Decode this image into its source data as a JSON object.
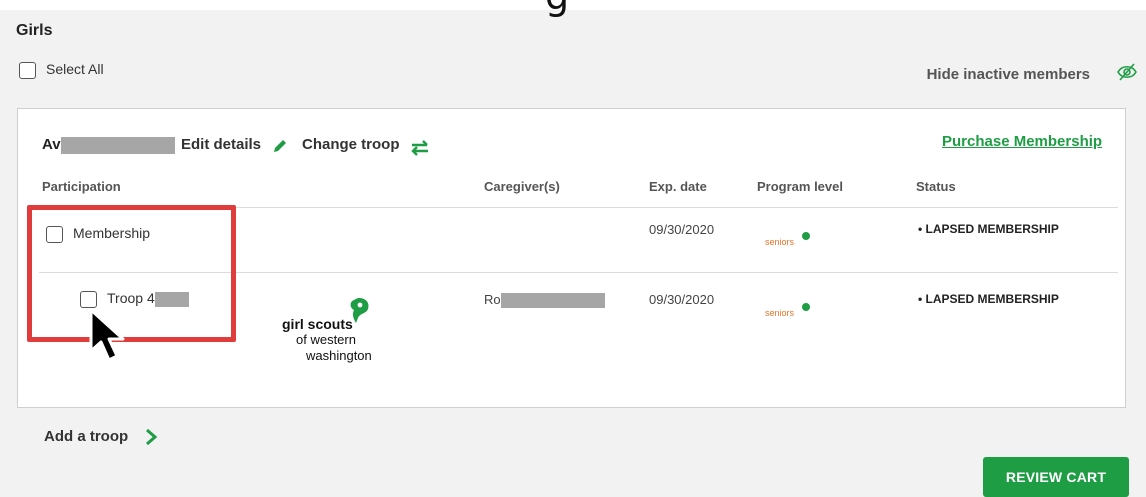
{
  "header": {
    "top_glyph": "g",
    "section_title": "Girls",
    "select_all_label": "Select All",
    "hide_inactive_label": "Hide inactive members"
  },
  "member": {
    "name_visible": "Av",
    "edit_details_label": "Edit details",
    "change_troop_label": "Change troop",
    "purchase_label": "Purchase Membership"
  },
  "table": {
    "columns": [
      "Participation",
      "Caregiver(s)",
      "Exp. date",
      "Program level",
      "Status"
    ],
    "rows": [
      {
        "participation": "Membership",
        "caregiver": "",
        "exp_date": "09/30/2020",
        "program_level": "seniors",
        "status": "• LAPSED MEMBERSHIP"
      },
      {
        "participation": "Troop 4",
        "caregiver": "Ro",
        "exp_date": "09/30/2020",
        "program_level": "seniors",
        "status": "• LAPSED MEMBERSHIP"
      }
    ]
  },
  "logo": {
    "line1": "girl scouts",
    "line2": "of western",
    "line3": "washington"
  },
  "footer": {
    "add_troop_label": "Add a troop",
    "review_cart_label": "REVIEW CART"
  },
  "colors": {
    "brand_green": "#1e9d45",
    "highlight_red": "#e03c3c",
    "level_orange": "#e8742a"
  },
  "icons": [
    "eye-slash-icon",
    "pencil-icon",
    "swap-arrows-icon",
    "chevron-right-icon",
    "trefoil-icon",
    "cursor-arrow-icon"
  ]
}
